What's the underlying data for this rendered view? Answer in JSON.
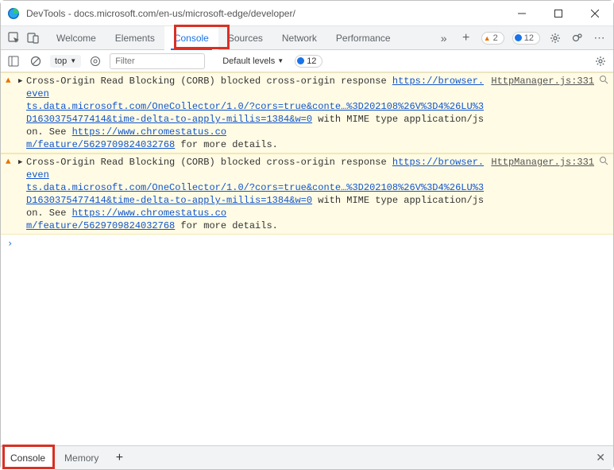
{
  "window": {
    "title": "DevTools - docs.microsoft.com/en-us/microsoft-edge/developer/"
  },
  "panelTabs": {
    "welcome": "Welcome",
    "elements": "Elements",
    "console": "Console",
    "sources": "Sources",
    "network": "Network",
    "performance": "Performance"
  },
  "badges": {
    "warnCount": "2",
    "infoCount": "12"
  },
  "consoleToolbar": {
    "context": "top",
    "filterPlaceholder": "Filter",
    "levels": "Default levels",
    "issuesCount": "12"
  },
  "log1": {
    "pre": "Cross-Origin Read Blocking (CORB) blocked cross-origin response ",
    "url1a": "https://browser.even",
    "url1b": "ts.data.microsoft.com/OneCollector/1.0/?cors=true&conte…%3D202108%26V%3D4%26LU%3D1630375477414&time-delta-to-apply-millis=1384&w=0",
    "mid": " with MIME type application/json. See ",
    "url2a": "https://www.chromestatus.co",
    "url2b": "m/feature/5629709824032768",
    "end": " for more details.",
    "source": "HttpManager.js:331"
  },
  "log2": {
    "pre": "Cross-Origin Read Blocking (CORB) blocked cross-origin response ",
    "url1a": "https://browser.even",
    "url1b": "ts.data.microsoft.com/OneCollector/1.0/?cors=true&conte…%3D202108%26V%3D4%26LU%3D1630375477414&time-delta-to-apply-millis=1384&w=0",
    "mid": " with MIME type application/json. See ",
    "url2a": "https://www.chromestatus.co",
    "url2b": "m/feature/5629709824032768",
    "end": " for more details.",
    "source": "HttpManager.js:331"
  },
  "drawer": {
    "console": "Console",
    "memory": "Memory"
  }
}
